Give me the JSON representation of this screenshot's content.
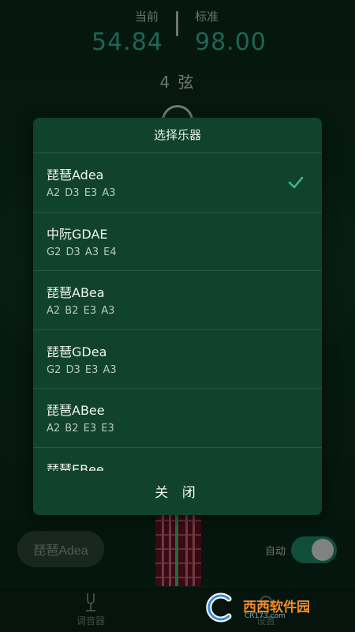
{
  "tuner": {
    "current_label": "当前",
    "current_value": "54.84",
    "standard_label": "标准",
    "standard_value": "98.00",
    "string_label": "4 弦"
  },
  "dialog": {
    "title": "选择乐器",
    "items": [
      {
        "name": "琵琶Adea",
        "notes": "A2  D3 E3  A3",
        "selected": true
      },
      {
        "name": "中阮GDAE",
        "notes": "G2  D3 A3  E4",
        "selected": false
      },
      {
        "name": "琵琶ABea",
        "notes": "A2  B2 E3  A3",
        "selected": false
      },
      {
        "name": "琵琶GDea",
        "notes": "G2 D3 E3  A3",
        "selected": false
      },
      {
        "name": "琵琶ABee",
        "notes": "A2  B2 E3  E3",
        "selected": false
      },
      {
        "name": "琵琶EBee",
        "notes": "",
        "selected": false
      }
    ],
    "close_label": "关 闭"
  },
  "bottom": {
    "instrument_label": "琵琶Adea",
    "auto_label": "自动",
    "auto_on": true
  },
  "tabs": [
    {
      "label": "调音器",
      "icon": "tuning-fork-icon"
    },
    {
      "label": "设置",
      "icon": "settings-icon"
    }
  ],
  "watermark": {
    "text": "西西软件园",
    "sub": "CR173.com"
  },
  "colors": {
    "accent": "#38b99a",
    "dialog_bg": "#11432c",
    "toggle_on": "#1e8f6a"
  }
}
